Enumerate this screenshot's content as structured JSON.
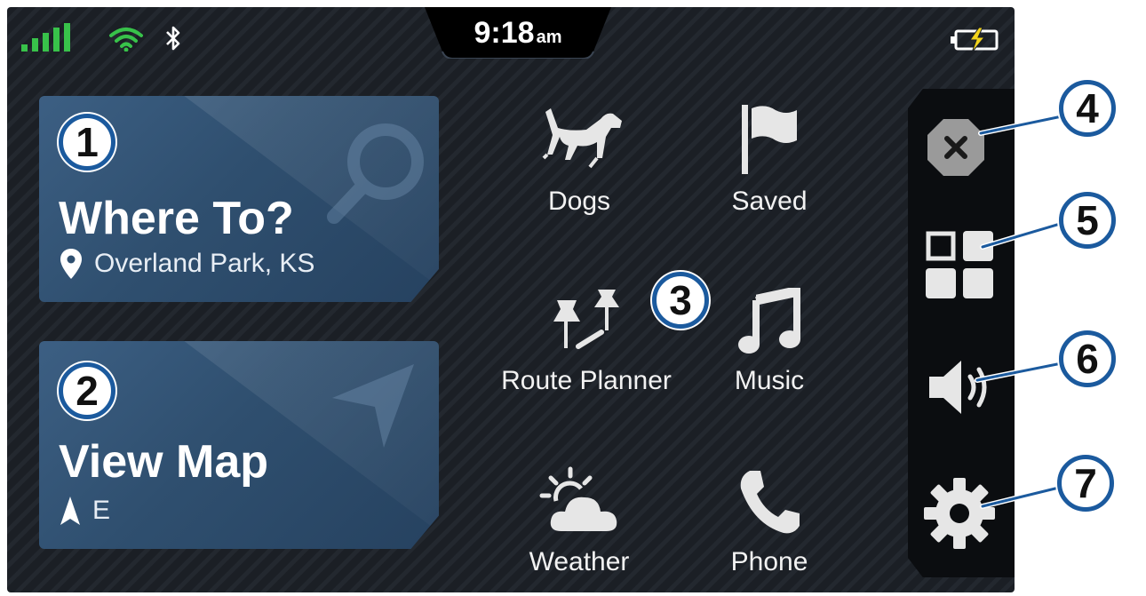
{
  "status_bar": {
    "time": "9:18",
    "ampm": "am",
    "icons": [
      "signal-icon",
      "wifi-icon",
      "bluetooth-icon",
      "battery-charging-icon"
    ]
  },
  "colors": {
    "signal": "#38c24a",
    "wifi": "#38c24a",
    "charge_bolt": "#f2d31b",
    "card": "#2f4f6f",
    "callout_border": "#1b5a9e"
  },
  "cards": {
    "where_to": {
      "title": "Where To?",
      "location": "Overland Park, KS",
      "icons": [
        "location-pin-icon",
        "search-icon"
      ]
    },
    "view_map": {
      "title": "View Map",
      "heading": "E",
      "icons": [
        "heading-arrow-icon",
        "navigation-arrow-icon"
      ]
    }
  },
  "apps": [
    {
      "label": "Dogs",
      "icon": "dog-icon"
    },
    {
      "label": "Saved",
      "icon": "flag-icon"
    },
    {
      "label": "Route Planner",
      "icon": "route-planner-icon"
    },
    {
      "label": "Music",
      "icon": "music-note-icon"
    },
    {
      "label": "Weather",
      "icon": "weather-icon"
    },
    {
      "label": "Phone",
      "icon": "phone-icon"
    }
  ],
  "side_panel": [
    "stop-icon",
    "apps-grid-icon",
    "volume-icon",
    "settings-gear-icon"
  ],
  "callouts": [
    "1",
    "2",
    "3",
    "4",
    "5",
    "6",
    "7"
  ]
}
